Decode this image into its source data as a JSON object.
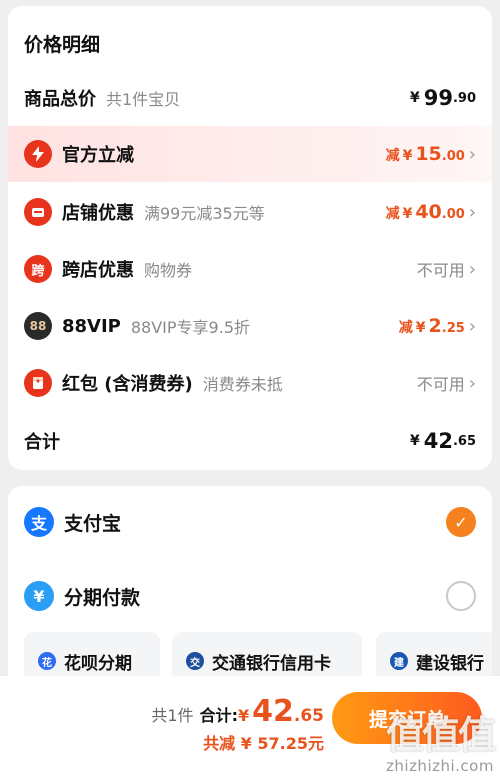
{
  "price_detail": {
    "title": "价格明细",
    "goods_total": {
      "label": "商品总价",
      "sub": "共1件宝贝",
      "currency": "¥",
      "int": "99",
      "dec": ".90"
    },
    "discounts": [
      {
        "icon": "lightning-icon",
        "label": "官方立减",
        "sub": "",
        "prefix": "减",
        "currency": "¥",
        "int": "15",
        "dec": ".00",
        "color": "#e8331d"
      },
      {
        "icon": "shop-icon",
        "label": "店铺优惠",
        "sub": "满99元减35元等",
        "prefix": "减",
        "currency": "¥",
        "int": "40",
        "dec": ".00",
        "color": "#e8331d"
      },
      {
        "icon": "cross-store-icon",
        "label": "跨店优惠",
        "sub": "购物券",
        "status": "不可用",
        "glyph": "跨",
        "color": "#e8331d"
      },
      {
        "icon": "88vip-icon",
        "label": "88VIP",
        "sub": "88VIP专享9.5折",
        "prefix": "减",
        "currency": "¥",
        "int": "2",
        "dec": ".25",
        "glyph": "88",
        "color": "#2a2a2a"
      },
      {
        "icon": "red-packet-icon",
        "label": "红包 (含消费券)",
        "sub": "消费券未抵",
        "status": "不可用",
        "color": "#e8331d"
      }
    ],
    "total": {
      "label": "合计",
      "currency": "¥",
      "int": "42",
      "dec": ".65"
    }
  },
  "payment": {
    "alipay": {
      "label": "支付宝",
      "glyph": "支",
      "color": "#1677ff",
      "selected": true
    },
    "installment": {
      "label": "分期付款",
      "glyph": "¥",
      "color": "#2a9df4",
      "selected": false
    },
    "options": [
      {
        "label": "花呗分期",
        "icon": "huabei-icon",
        "color": "#2e6cf6"
      },
      {
        "label": "交通银行信用卡",
        "icon": "bocom-icon",
        "color": "#1d4f9e"
      },
      {
        "label": "建设银行",
        "icon": "ccb-icon",
        "color": "#1a57b3"
      }
    ]
  },
  "footer": {
    "count": "共1件",
    "total_label": "合计:",
    "currency": "¥",
    "int": "42",
    "dec": ".65",
    "saved": "共减 ¥ 57.25元",
    "submit": "提交订单",
    "watermark_logo": "值值值",
    "watermark_url": "zhizhizhi.com"
  },
  "colors": {
    "accent": "#e8531d",
    "brand_orange": "#f5821f"
  }
}
